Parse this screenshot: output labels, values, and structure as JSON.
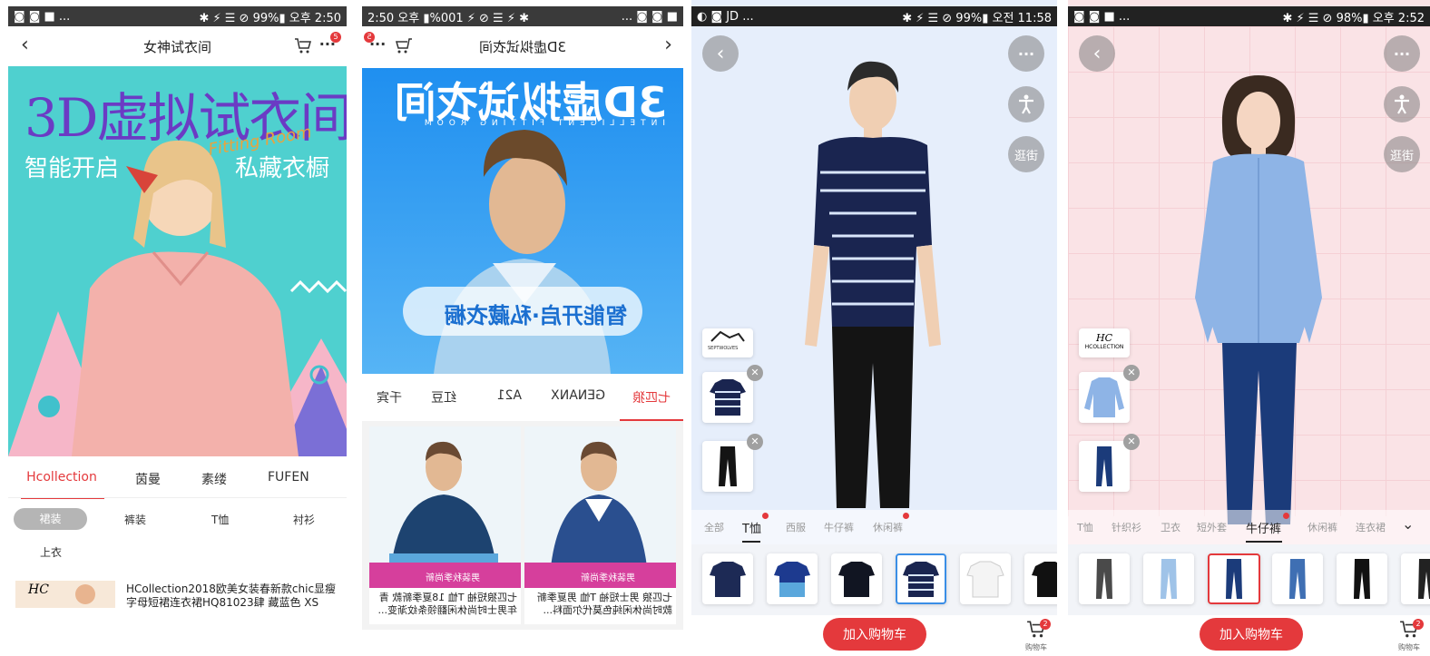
{
  "panel1": {
    "status_left": "◙ ◙ ■ ...",
    "status_right": "✱ ⚡ ☰ ⊘ 99%▮ 오후 2:50",
    "title": "女神试衣间",
    "badge": "5",
    "banner_title": "3D虚拟试衣间",
    "banner_script": "Fitting Room",
    "banner_left": "智能开启",
    "banner_right": "私藏衣橱",
    "brand_tabs": [
      "Hcollection",
      "茵曼",
      "素缕",
      "FUFEN"
    ],
    "categories": [
      "裙装",
      "裤装",
      "T恤",
      "衬衫",
      "上衣"
    ],
    "product_logo": "HC",
    "product_title": "HCollection2018欧美女装春新款chic显瘦字母短裙连衣裙HQ81023肆 藏蓝色 XS"
  },
  "panel2": {
    "status_left": "2:50 오후 ▮%001 ⚡ ⊘ ☰ ⚡ ✱",
    "status_right": "... ◙ ◙ ■",
    "title": "3D虚拟试衣间",
    "badge": "5",
    "banner_title": "3D虚拟试衣间",
    "banner_sub": "INTELLIGENT FITTING ROOM",
    "banner_slogan": "智能开启·私藏衣橱",
    "brand_tabs": [
      "七匹狼",
      "GENANX",
      "A21",
      "红豆",
      "千宾"
    ],
    "product_tag": "男装秋季尚新",
    "products": [
      {
        "title": "七匹狼 男士短袖 T恤 男夏季新款时尚休闲纯色莫代尔面料..."
      },
      {
        "title": "七匹狼短袖 T恤 18夏季新款 青年男士时尚休闲翻领条纹渐变..."
      }
    ]
  },
  "panel3": {
    "status_left": "◐ ◙ JD ...",
    "status_right": "✱ ⚡ ☰ ⊘ 99%▮ 오전 11:58",
    "street_label": "逛街",
    "brand_logo": "SEPTWOLVES",
    "categories": [
      "全部",
      "T恤",
      "西服",
      "牛仔裤",
      "休闲裤"
    ],
    "active_category": "T恤",
    "add_cart": "加入购物车",
    "cart_label": "购物车",
    "cart_badge": "2",
    "colors": {
      "accent": "#e4393c",
      "selected": "#3a8ee6",
      "bg": "#e6eefb"
    }
  },
  "panel4": {
    "status_left": "◙ ◙ ■ ...",
    "status_right": "✱ ⚡ ☰ ⊘ 98%▮ 오후 2:52",
    "street_label": "逛街",
    "brand_logo": "HC",
    "brand_logo_sub": "HCOLLECTION",
    "categories": [
      "T恤",
      "针织衫",
      "卫衣",
      "短外套",
      "牛仔裤",
      "休闲裤",
      "连衣裙"
    ],
    "active_category": "牛仔裤",
    "add_cart": "加入购物车",
    "cart_label": "购物车",
    "cart_badge": "2",
    "colors": {
      "accent": "#e4393c",
      "selected": "#e4393c",
      "bg": "#fae3e6"
    }
  }
}
